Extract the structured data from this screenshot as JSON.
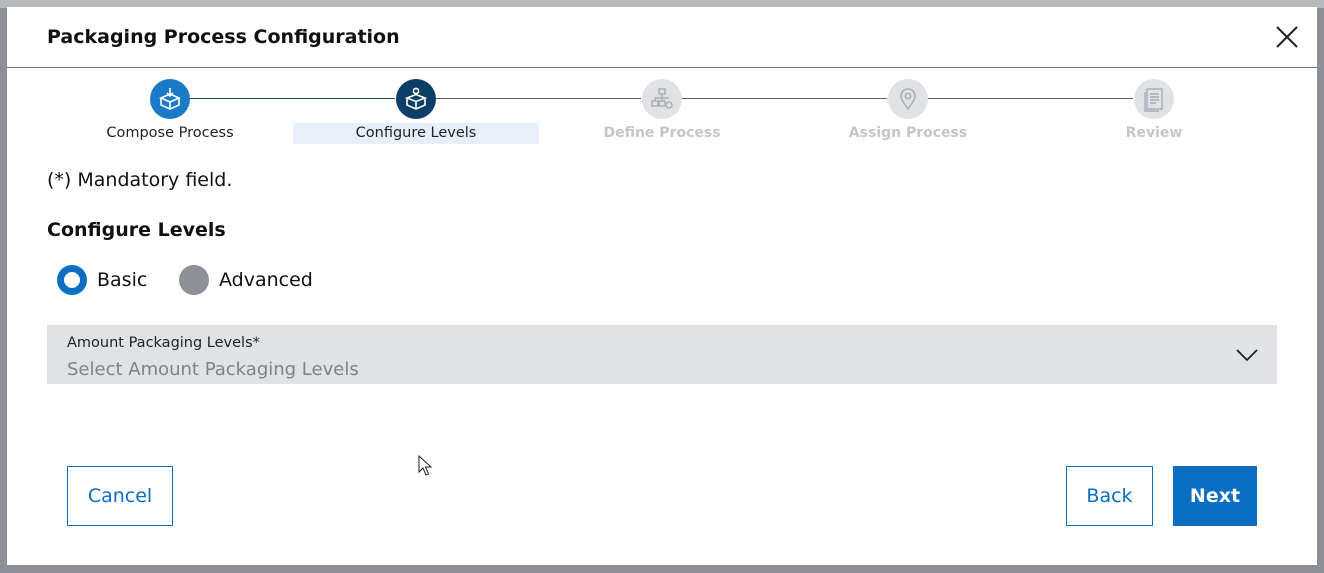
{
  "dialog": {
    "title": "Packaging Process Configuration",
    "close_icon": "close-icon"
  },
  "stepper": {
    "steps": [
      {
        "label": "Compose Process",
        "icon": "box-download-icon",
        "state": "completed"
      },
      {
        "label": "Configure Levels",
        "icon": "box-gear-icon",
        "state": "active"
      },
      {
        "label": "Define Process",
        "icon": "hierarchy-gear-icon",
        "state": "inactive"
      },
      {
        "label": "Assign Process",
        "icon": "location-pin-icon",
        "state": "inactive"
      },
      {
        "label": "Review",
        "icon": "document-list-icon",
        "state": "inactive"
      }
    ]
  },
  "form": {
    "mandatory_note": "(*) Mandatory field.",
    "section_title": "Configure Levels",
    "mode_options": [
      {
        "label": "Basic",
        "selected": true
      },
      {
        "label": "Advanced",
        "selected": false
      }
    ],
    "amount_levels": {
      "label": "Amount Packaging Levels*",
      "placeholder": "Select Amount Packaging Levels"
    }
  },
  "footer": {
    "cancel_label": "Cancel",
    "back_label": "Back",
    "next_label": "Next"
  },
  "colors": {
    "primary": "#0a6fc2",
    "step_completed": "#1a7ac8",
    "step_active": "#0c3e66",
    "step_inactive": "#e0e2e5",
    "field_background": "#e0e2e5"
  }
}
